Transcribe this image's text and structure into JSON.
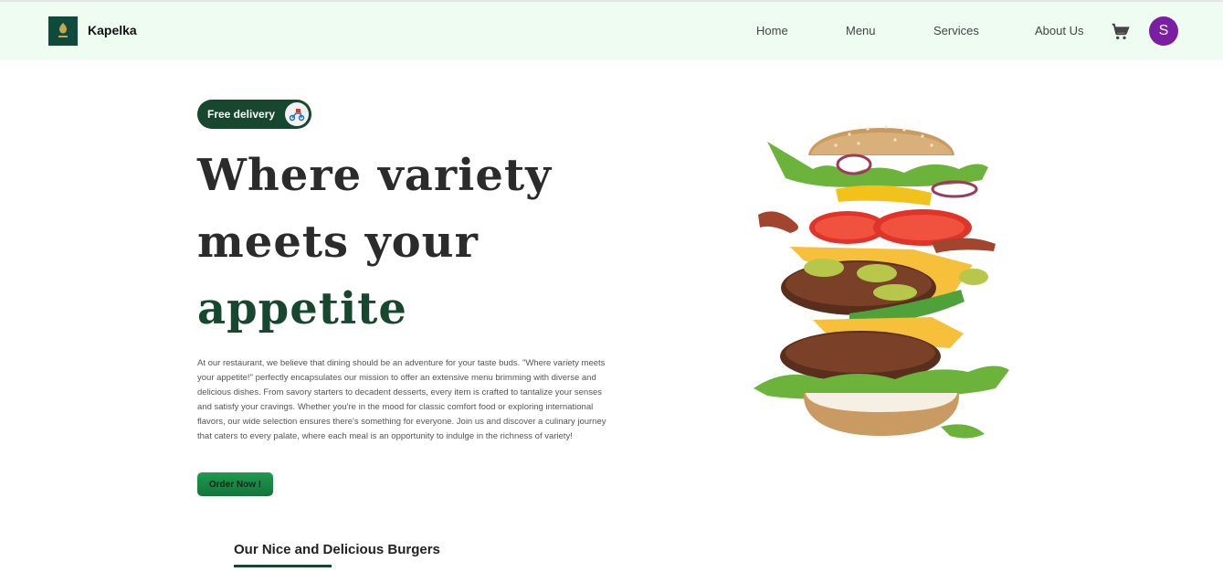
{
  "navbar": {
    "brand": "Kapelka",
    "links": [
      "Home",
      "Menu",
      "Services",
      "About Us"
    ],
    "cart_icon": "cart-icon",
    "avatar_initial": "S",
    "avatar_color": "#7b1fa2",
    "background": "#effcf1"
  },
  "hero": {
    "badge_label": "Free delivery",
    "badge_icon": "delivery-scooter-icon",
    "headline_line1": "Where variety",
    "headline_line2": "meets your",
    "headline_line3": "appetite",
    "description": "At our restaurant, we believe that dining should be an adventure for your taste buds. \"Where variety meets your appetite!\" perfectly encapsulates our mission to offer an extensive menu brimming with diverse and delicious dishes. From savory starters to decadent desserts, every item is crafted to tantalize your senses and satisfy your cravings. Whether you're in the mood for classic comfort food or exploring international flavors, our wide selection ensures there's something for everyone. Join us and discover a culinary journey that caters to every palate, where each meal is an opportunity to indulge in the richness of variety!",
    "cta_label": "Order Now !",
    "accent_color": "#17472f"
  },
  "section": {
    "title": "Our Nice and Delicious Burgers"
  }
}
